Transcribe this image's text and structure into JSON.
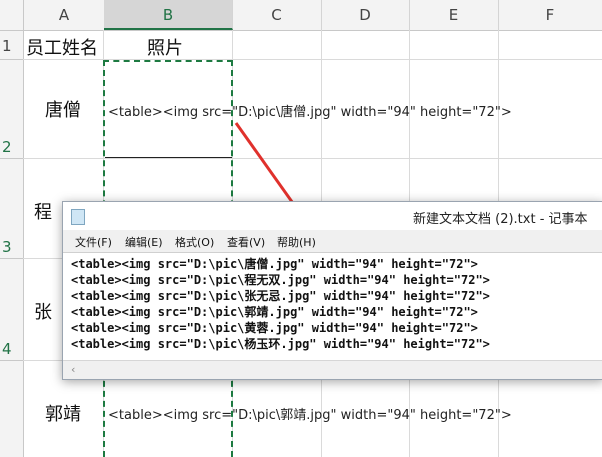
{
  "spreadsheet": {
    "columns": [
      "A",
      "B",
      "C",
      "D",
      "E",
      "F"
    ],
    "rows": [
      "1",
      "2",
      "3",
      "4"
    ],
    "header_row": {
      "a1": "员工姓名",
      "b1": "照片"
    },
    "names": {
      "row2": "唐僧",
      "row3": "程",
      "row4": "张",
      "row5": "郭靖"
    },
    "formulas": {
      "row2": "<table><img src=\"D:\\pic\\唐僧.jpg\" width=\"94\" height=\"72\">",
      "row5": "<table><img src=\"D:\\pic\\郭靖.jpg\" width=\"94\" height=\"72\">"
    }
  },
  "notepad": {
    "title": "新建文本文档 (2).txt - 记事本",
    "menu": [
      "文件(F)",
      "编辑(E)",
      "格式(O)",
      "查看(V)",
      "帮助(H)"
    ],
    "lines": [
      "<table><img src=\"D:\\pic\\唐僧.jpg\" width=\"94\" height=\"72\">",
      "<table><img src=\"D:\\pic\\程无双.jpg\" width=\"94\" height=\"72\">",
      "<table><img src=\"D:\\pic\\张无忌.jpg\" width=\"94\" height=\"72\">",
      "<table><img src=\"D:\\pic\\郭靖.jpg\" width=\"94\" height=\"72\">",
      "<table><img src=\"D:\\pic\\黄蓉.jpg\" width=\"94\" height=\"72\">",
      "<table><img src=\"D:\\pic\\杨玉环.jpg\" width=\"94\" height=\"72\">"
    ],
    "scroll_left_icon": "‹"
  },
  "colors": {
    "excel_green": "#217346",
    "arrow_red": "#e0312c"
  }
}
